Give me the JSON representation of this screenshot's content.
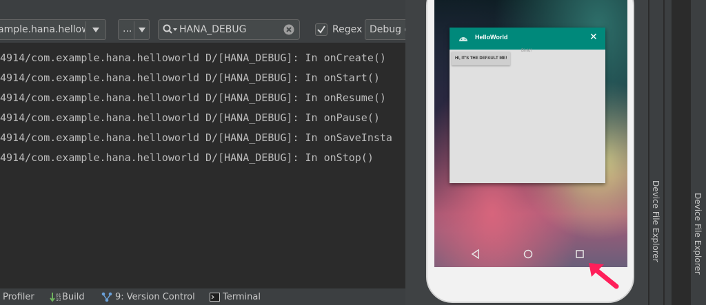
{
  "logcat": {
    "toolbar": {
      "process_value": "ample.hana.hellowo",
      "level_value": "...",
      "search_value": "HANA_DEBUG",
      "regex_label": "Regex",
      "regex_checked": true,
      "filter_value": "Debug o"
    },
    "lines": [
      "4914/com.example.hana.helloworld D/[HANA_DEBUG]: In onCreate()",
      "4914/com.example.hana.helloworld D/[HANA_DEBUG]: In onStart()",
      "4914/com.example.hana.helloworld D/[HANA_DEBUG]: In onResume()",
      "4914/com.example.hana.helloworld D/[HANA_DEBUG]: In onPause()",
      "4914/com.example.hana.helloworld D/[HANA_DEBUG]: In onSaveInsta",
      "4914/com.example.hana.helloworld D/[HANA_DEBUG]: In onStop()"
    ]
  },
  "bottombar": {
    "items": [
      {
        "label": "Profiler",
        "icon": "profiler-icon"
      },
      {
        "label": "Build",
        "icon": "build-icon"
      },
      {
        "label": "9: Version Control",
        "icon": "version-control-icon"
      },
      {
        "label": "Terminal",
        "icon": "terminal-icon"
      }
    ]
  },
  "emulator": {
    "recent_card": {
      "app_title": "HelloWorld",
      "message_button": "HI, IT'S THE DEFAULT ME!",
      "hint_text": "Binld!",
      "header_color": "#00897b"
    },
    "navbar": [
      "back-icon",
      "home-icon",
      "recents-icon"
    ],
    "annotation_arrow_color": "#ff1f5a"
  },
  "side_panels": {
    "left_label": "Device File Explorer",
    "right_label": "Device File Explorer"
  }
}
